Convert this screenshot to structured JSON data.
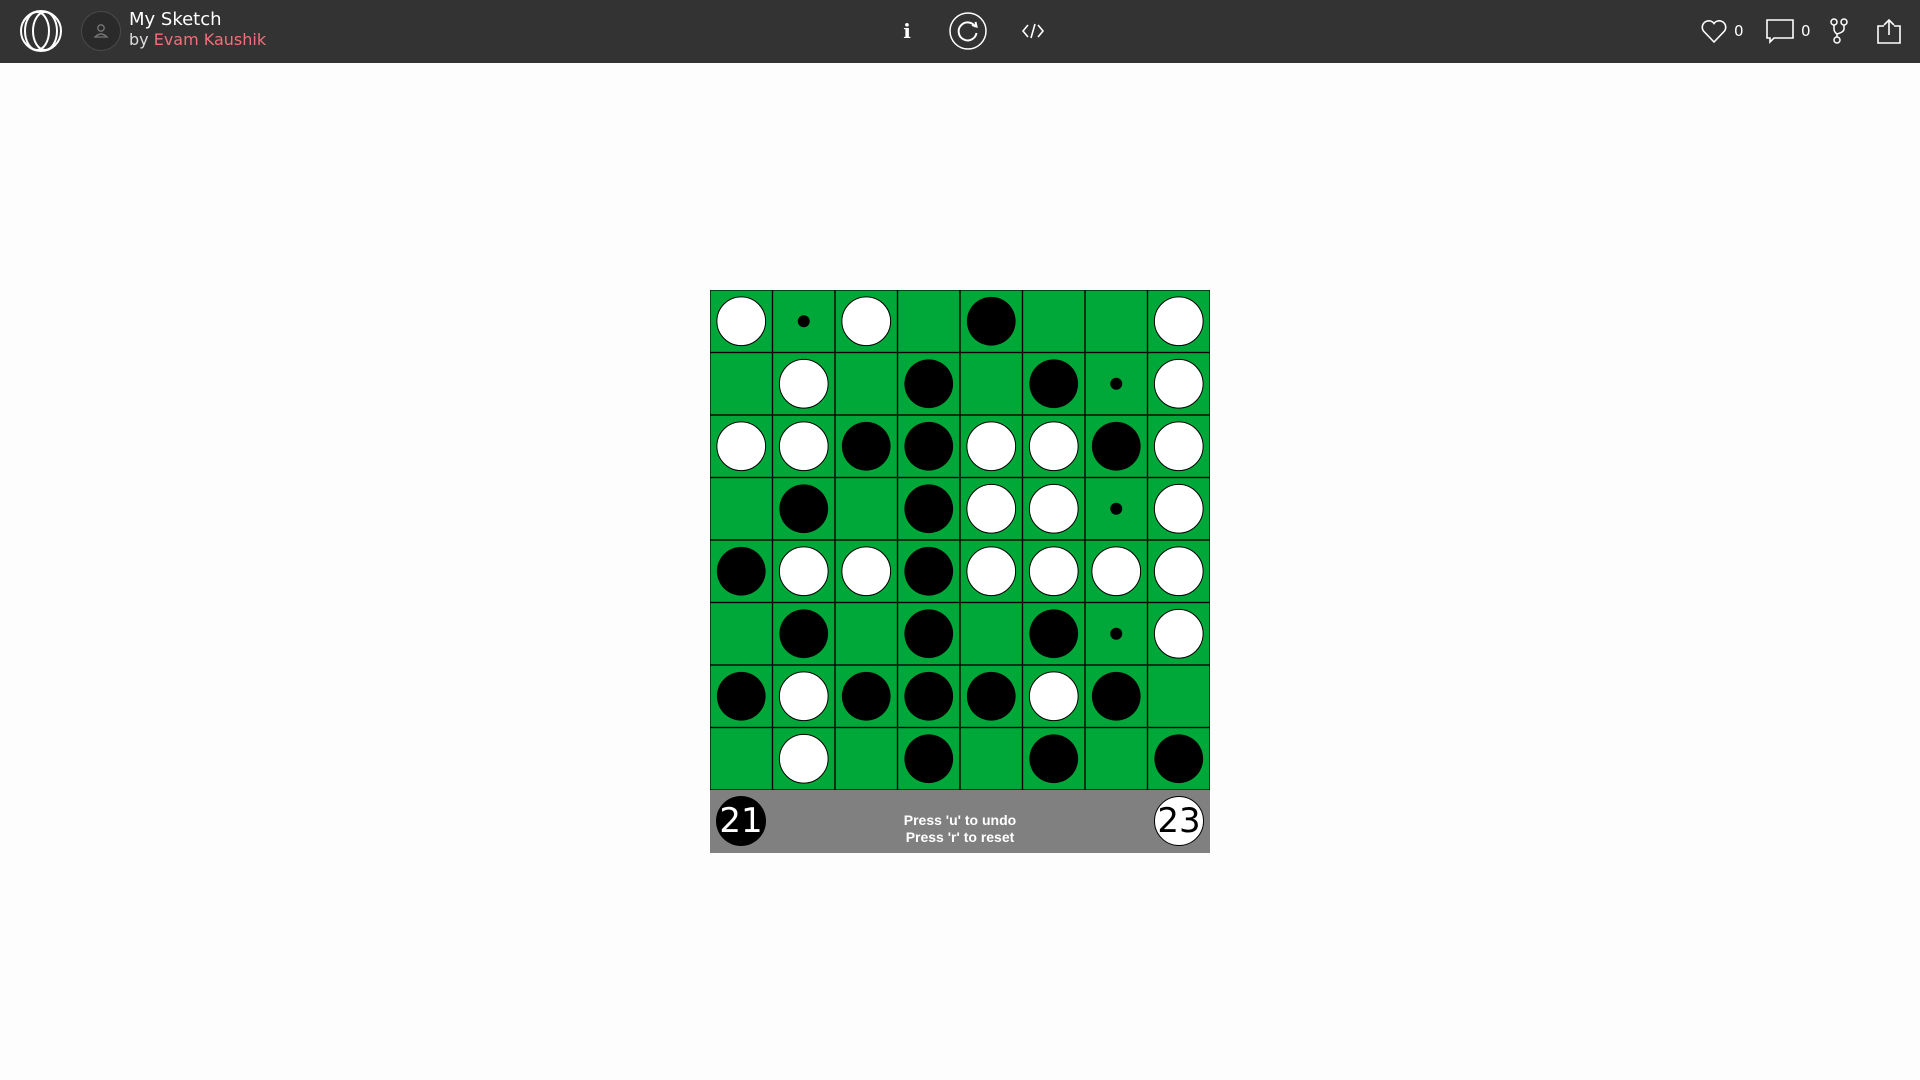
{
  "header": {
    "sketch_title": "My Sketch",
    "by_prefix": "by",
    "author": "Evam Kaushik",
    "info_label": "i",
    "likes_count": "0",
    "comments_count": "0"
  },
  "icons": {
    "logo": "openprocessing-logo-icon",
    "avatar": "user-avatar-icon",
    "info": "info-icon",
    "restart": "restart-icon",
    "code": "code-icon",
    "like": "heart-icon",
    "comments": "comment-icon",
    "fork": "fork-icon",
    "share": "share-icon"
  },
  "game": {
    "board_rows": [
      "WdW.B..W",
      ".W.B.BdW",
      "WWBBWWBW",
      ".B.BWWdW",
      "BWWBWWWW",
      ".B.B.BdW",
      "BWBBBWB.",
      ".W.B.B.B"
    ],
    "legend": {
      "W": "white piece",
      "B": "black piece",
      "d": "valid move marker",
      ".": "empty"
    },
    "black_score": "21",
    "white_score": "23",
    "help_line_1": "Press 'u' to undo",
    "help_line_2": "Press 'r' to reset"
  },
  "colors": {
    "topbar": "#333333",
    "board_green": "#00a83a",
    "grid_line": "#000000",
    "footer": "#808080",
    "author": "#f0707a"
  }
}
